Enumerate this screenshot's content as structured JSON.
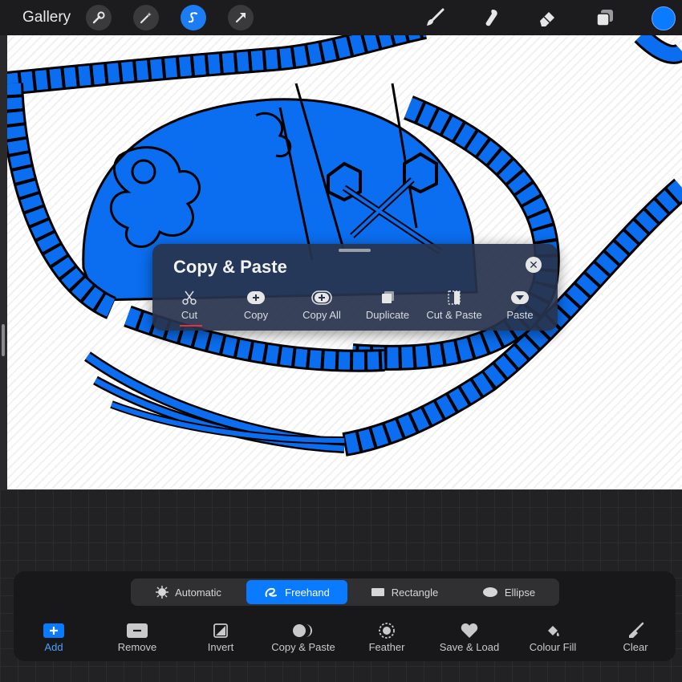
{
  "topbar": {
    "gallery_label": "Gallery",
    "left_tools": [
      "wrench-icon",
      "magic-wand-icon",
      "selection-icon",
      "transform-arrow-icon"
    ],
    "right_tools": [
      "brush-icon",
      "smudge-icon",
      "eraser-icon",
      "layers-icon"
    ],
    "current_color": "#0a7aff"
  },
  "copy_paste_panel": {
    "title": "Copy & Paste",
    "items": [
      {
        "label": "Cut",
        "icon": "scissors-icon",
        "active": true
      },
      {
        "label": "Copy",
        "icon": "copy-plus-icon"
      },
      {
        "label": "Copy All",
        "icon": "copy-all-icon"
      },
      {
        "label": "Duplicate",
        "icon": "duplicate-icon"
      },
      {
        "label": "Cut & Paste",
        "icon": "cut-paste-icon"
      },
      {
        "label": "Paste",
        "icon": "paste-icon"
      }
    ]
  },
  "selection_panel": {
    "modes": [
      {
        "label": "Automatic",
        "icon": "automatic-icon"
      },
      {
        "label": "Freehand",
        "icon": "freehand-icon",
        "active": true
      },
      {
        "label": "Rectangle",
        "icon": "rectangle-icon"
      },
      {
        "label": "Ellipse",
        "icon": "ellipse-icon"
      }
    ],
    "tools": [
      {
        "label": "Add",
        "icon": "add-icon",
        "active": true
      },
      {
        "label": "Remove",
        "icon": "remove-icon"
      },
      {
        "label": "Invert",
        "icon": "invert-icon"
      },
      {
        "label": "Copy & Paste",
        "icon": "copy-paste-icon"
      },
      {
        "label": "Feather",
        "icon": "feather-icon"
      },
      {
        "label": "Save & Load",
        "icon": "heart-icon"
      },
      {
        "label": "Colour Fill",
        "icon": "colour-fill-icon"
      },
      {
        "label": "Clear",
        "icon": "clear-brush-icon"
      }
    ]
  },
  "colors": {
    "accent": "#0a7aff",
    "artwork_fill": "#0b6ef0",
    "underline": "#e0343c"
  }
}
